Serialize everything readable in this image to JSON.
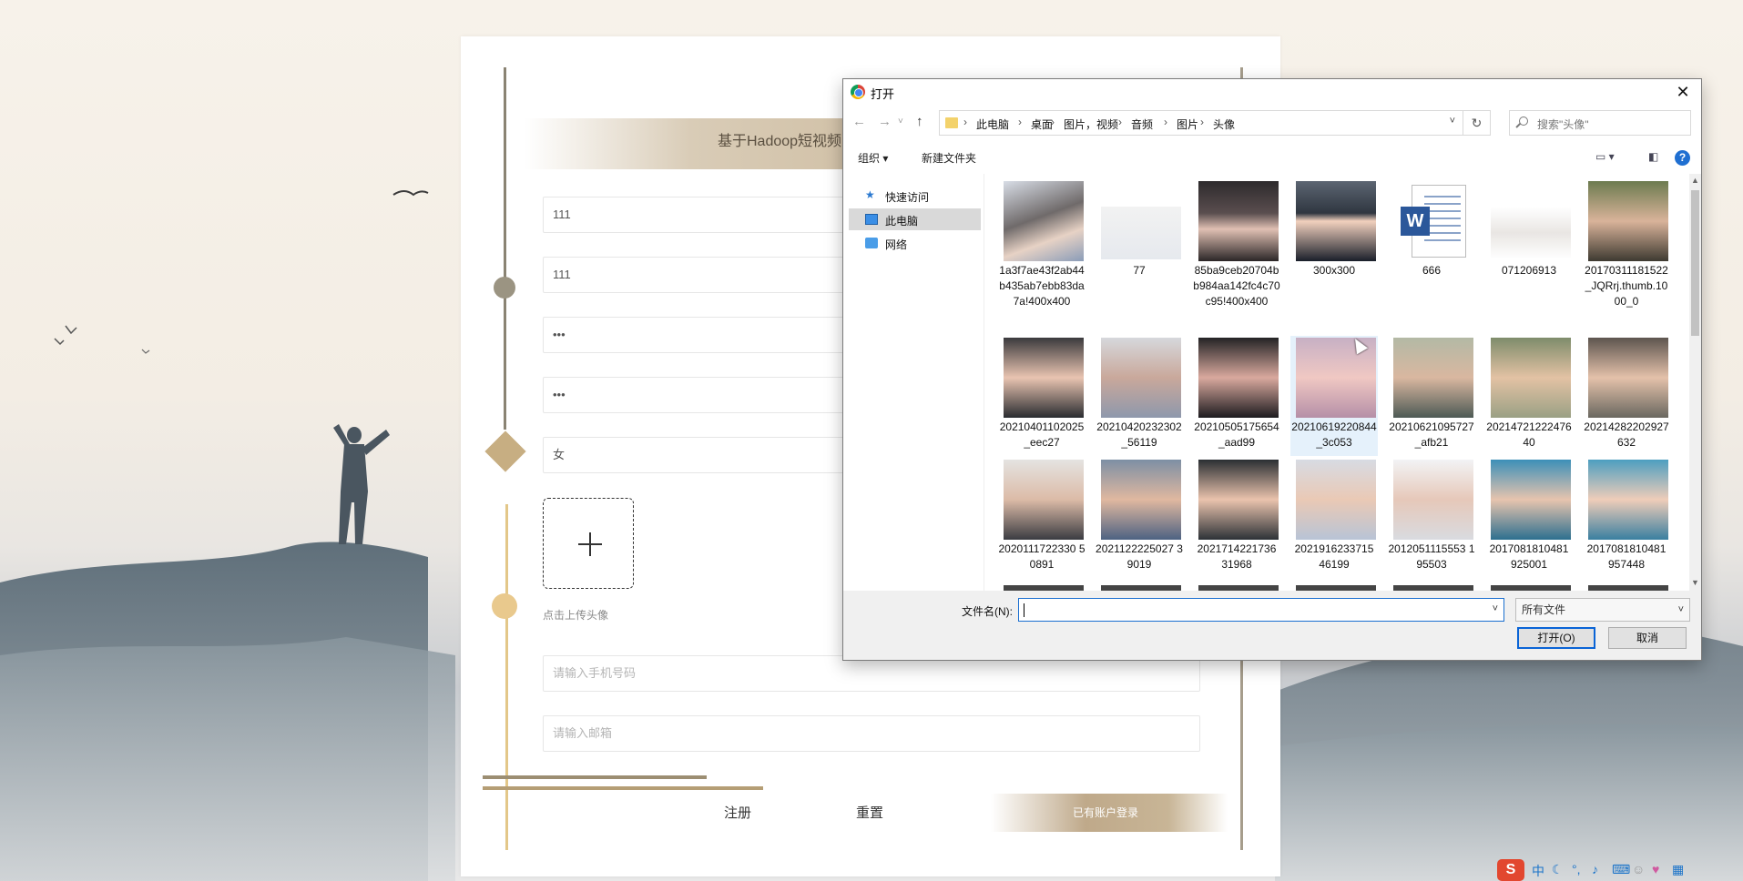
{
  "colors": {
    "accent_gold": "#c7ae82",
    "deco_brown": "#8a8373",
    "dialog_primary_blue": "#0a64d6"
  },
  "register": {
    "title": "基于Hadoop短视频",
    "username": "111",
    "nickname": "111",
    "password": "•••",
    "confirm_password": "•••",
    "gender": "女",
    "upload_hint": "点击上传头像",
    "phone_placeholder": "请输入手机号码",
    "email_placeholder": "请输入邮箱",
    "register_label": "注册",
    "reset_label": "重置",
    "login_link": "已有账户登录"
  },
  "dialog": {
    "title": "打开",
    "close": "✕",
    "breadcrumb": [
      "此电脑",
      "桌面",
      "图片，视频",
      "音频",
      "图片",
      "头像"
    ],
    "search_placeholder": "搜索\"头像\"",
    "organize_label": "组织 ▾",
    "new_folder_label": "新建文件夹",
    "help": "?",
    "nav": [
      {
        "label": "快速访问",
        "icon": "star-icon"
      },
      {
        "label": "此电脑",
        "icon": "computer-icon"
      },
      {
        "label": "网络",
        "icon": "network-icon"
      }
    ],
    "files": [
      {
        "label": "1a3f7ae43f2ab44b435ab7ebb83da7a!400x400"
      },
      {
        "label": "77"
      },
      {
        "label": "85ba9ceb20704bb984aa142fc4c70c95!400x400"
      },
      {
        "label": "300x300"
      },
      {
        "label": "666"
      },
      {
        "label": "071206913"
      },
      {
        "label": "20170311181522_JQRrj.thumb.1000_0"
      },
      {
        "label": "20210401102025_eec27"
      },
      {
        "label": "20210420232302_56119"
      },
      {
        "label": "20210505175654_aad99"
      },
      {
        "label": "20210619220844_3c053"
      },
      {
        "label": "20210621095727_afb21"
      },
      {
        "label": "2021472122247640"
      },
      {
        "label": "20214282202927632"
      },
      {
        "label": "2020111722330 50891"
      },
      {
        "label": "2021122225027 39019"
      },
      {
        "label": "2021714221736 31968"
      },
      {
        "label": "2021916233715 46199"
      },
      {
        "label": "2012051115553 195503"
      },
      {
        "label": "2017081810481 925001"
      },
      {
        "label": "2017081810481 957448"
      }
    ],
    "filename_label": "文件名(N):",
    "filename_value": "",
    "filetype": "所有文件",
    "open_label": "打开(O)",
    "cancel_label": "取消"
  },
  "ime": {
    "brand": "S",
    "lang": "中"
  }
}
